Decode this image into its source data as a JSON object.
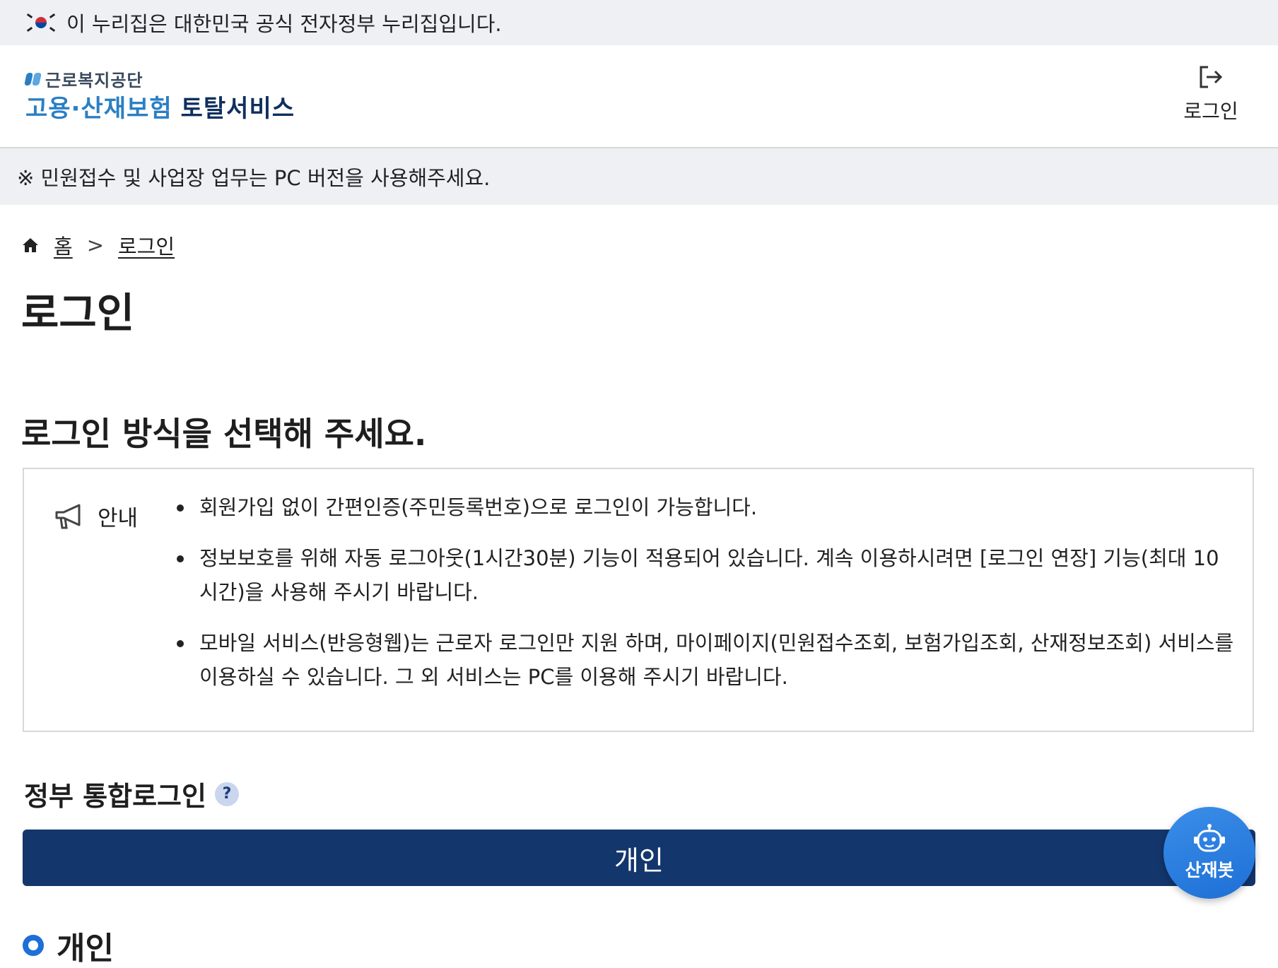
{
  "gov_banner": {
    "text": "이 누리집은 대한민국 공식 전자정부 누리집입니다."
  },
  "header": {
    "org_name": "근로복지공단",
    "service_name_a": "고용·산재보험",
    "service_name_b": "토탈서비스",
    "login_label": "로그인"
  },
  "notice": {
    "text": "※ 민원접수 및 사업장 업무는 PC 버전을 사용해주세요."
  },
  "breadcrumb": {
    "home": "홈",
    "current": "로그인"
  },
  "page_title": "로그인",
  "section_title": "로그인 방식을 선택해 주세요.",
  "info": {
    "label": "안내",
    "items": [
      "회원가입 없이 간편인증(주민등록번호)으로 로그인이 가능합니다.",
      "정보보호를 위해 자동 로그아웃(1시간30분) 기능이 적용되어 있습니다. 계속 이용하시려면 [로그인 연장] 기능(최대 10시간)을 사용해 주시기 바랍니다.",
      "모바일 서비스(반응형웹)는 근로자 로그인만 지원 하며, 마이페이지(민원접수조회, 보험가입조회, 산재정보조회) 서비스를 이용하실 수 있습니다. 그 외 서비스는 PC를 이용해 주시기 바랍니다."
    ]
  },
  "sso": {
    "title": "정부 통합로그인",
    "help": "?",
    "button_label": "개인"
  },
  "radio": {
    "label": "개인"
  },
  "chatbot": {
    "label": "산재봇"
  },
  "colors": {
    "primary": "#13366c",
    "accent": "#1e6fd6",
    "bar_bg": "#eef0f4"
  }
}
